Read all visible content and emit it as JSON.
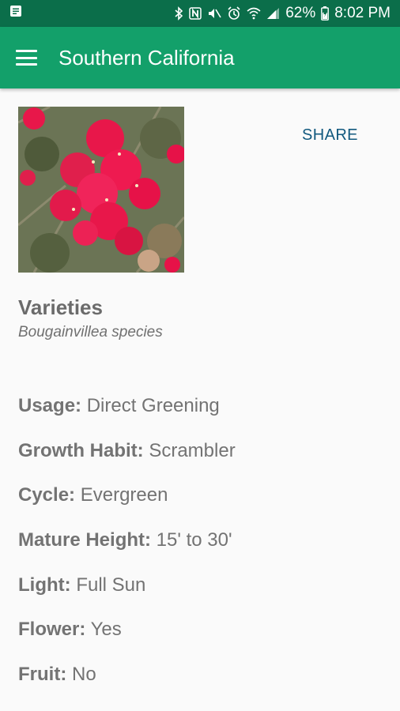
{
  "status_bar": {
    "battery": "62%",
    "time": "8:02 PM",
    "icons": [
      "notification-icon",
      "bluetooth-icon",
      "nfc-icon",
      "mute-icon",
      "alarm-icon",
      "wifi-icon",
      "signal-icon",
      "battery-charging-icon"
    ]
  },
  "app_bar": {
    "title": "Southern California",
    "menu_icon": "hamburger-menu-icon"
  },
  "plant": {
    "name": "Varieties",
    "species": "Bougainvillea species",
    "share_label": "SHARE",
    "attributes": [
      {
        "label": "Usage:",
        "value": "Direct Greening"
      },
      {
        "label": "Growth Habit:",
        "value": "Scrambler"
      },
      {
        "label": "Cycle:",
        "value": "Evergreen"
      },
      {
        "label": "Mature Height:",
        "value": "15' to 30'"
      },
      {
        "label": "Light:",
        "value": "Full Sun"
      },
      {
        "label": "Flower:",
        "value": "Yes"
      },
      {
        "label": "Fruit:",
        "value": "No"
      }
    ]
  },
  "colors": {
    "status_bar": "#0b6e4a",
    "app_bar": "#13a06a",
    "share": "#12597f",
    "text": "#737373",
    "flower": "#e8174a"
  }
}
